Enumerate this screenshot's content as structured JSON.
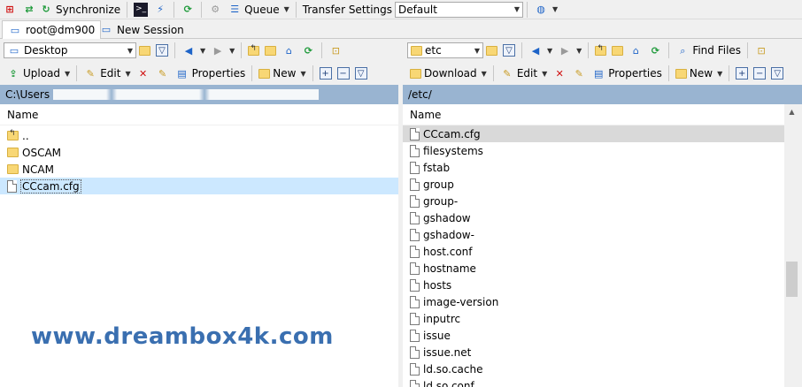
{
  "toolbar": {
    "synchronize_label": "Synchronize",
    "queue_label": "Queue",
    "transfer_settings_label": "Transfer Settings",
    "transfer_settings_value": "Default"
  },
  "tabs": [
    {
      "label": "root@dm900"
    },
    {
      "label": "New Session"
    }
  ],
  "left": {
    "location_value": "Desktop",
    "upload_label": "Upload",
    "edit_label": "Edit",
    "properties_label": "Properties",
    "new_label": "New",
    "path": "C:\\Users",
    "column_name": "Name",
    "items": [
      {
        "name": "..",
        "type": "parent"
      },
      {
        "name": "OSCAM",
        "type": "folder"
      },
      {
        "name": "NCAM",
        "type": "folder"
      },
      {
        "name": "CCcam.cfg",
        "type": "file"
      }
    ]
  },
  "right": {
    "location_value": "etc",
    "find_files_label": "Find Files",
    "download_label": "Download",
    "edit_label": "Edit",
    "properties_label": "Properties",
    "new_label": "New",
    "path": "/etc/",
    "column_name": "Name",
    "items": [
      {
        "name": "CCcam.cfg"
      },
      {
        "name": "filesystems"
      },
      {
        "name": "fstab"
      },
      {
        "name": "group"
      },
      {
        "name": "group-"
      },
      {
        "name": "gshadow"
      },
      {
        "name": "gshadow-"
      },
      {
        "name": "host.conf"
      },
      {
        "name": "hostname"
      },
      {
        "name": "hosts"
      },
      {
        "name": "image-version"
      },
      {
        "name": "inputrc"
      },
      {
        "name": "issue"
      },
      {
        "name": "issue.net"
      },
      {
        "name": "ld.so.cache"
      },
      {
        "name": "ld.so.conf"
      }
    ]
  },
  "watermark": "www.dreambox4k.com",
  "colors": {
    "path_bar": "#99b4d1",
    "selection": "#cce8ff",
    "watermark": "#3a6fb0"
  }
}
